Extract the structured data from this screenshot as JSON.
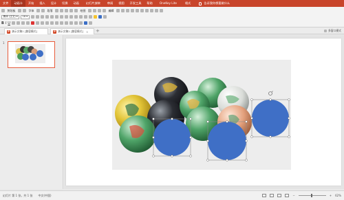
{
  "ribbon": {
    "tabs": [
      "文件",
      "动画卡 ",
      "开始",
      "插入",
      "设计",
      "切换",
      "动画",
      "幻灯片放映",
      "审阅",
      "视图",
      "开发工具",
      "帮助",
      "OneKey Lite",
      "格式"
    ],
    "active_tab": "动画卡 ",
    "tell_me": "告诉我你想要做什么"
  },
  "toolbar": {
    "row1": [
      "剪贴板",
      "字体",
      "段落",
      "绘图",
      "编辑"
    ],
    "font_name": "黑体 (正文)",
    "font_size": "18"
  },
  "doc_tabs": [
    {
      "label": "演示文稿1 [兼容模式]"
    },
    {
      "label": "演示文稿1 [兼容模式]"
    }
  ],
  "multi_window": "多窗口模式",
  "thumbnail": {
    "number": "1"
  },
  "status": {
    "slide_info": "幻灯片 第 1 张，共 1 张",
    "language": "中文(中国)",
    "zoom": "62%"
  },
  "colors": {
    "ribbon": "#c8442a",
    "circle_fill": "#3f6fc6"
  },
  "icons": [
    "lightbulb-icon",
    "powerpoint-icon",
    "close-icon",
    "add-icon",
    "rotate-handle-icon"
  ]
}
